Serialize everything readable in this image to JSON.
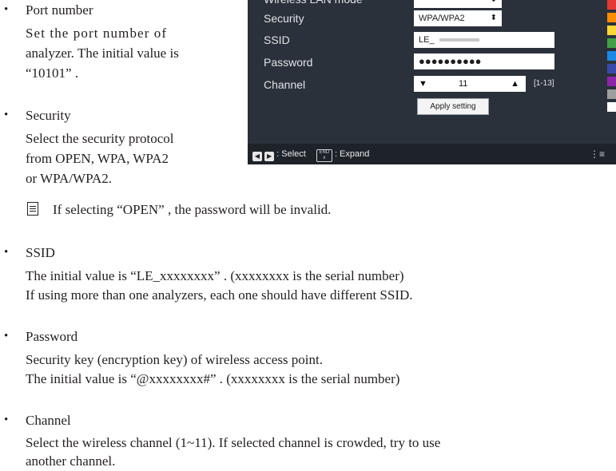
{
  "screen": {
    "rows": {
      "mode": "Wireless LAN mode",
      "security": "Security",
      "ssid": "SSID",
      "password": "Password",
      "channel": "Channel"
    },
    "security_value": "WPA/WPA2",
    "ssid_value": "LE_",
    "password_value": "●●●●●●●●●●",
    "channel_value": "11",
    "channel_range": "[1-13]",
    "apply_label": "Apply setting",
    "footer": {
      "select_label": ": Select",
      "expand_label": ": Expand",
      "key_label": "END"
    },
    "strip_colors": [
      "#e53935",
      "#fb8c00",
      "#fdd835",
      "#43a047",
      "#1e88e5",
      "#3949ab",
      "#8e24aa",
      "#9e9e9e",
      "#ffffff"
    ]
  },
  "doc": {
    "items": [
      {
        "bullet": "•",
        "term": "Port number",
        "desc": [
          "Set the port number of",
          "analyzer. The initial value is",
          "“10101” ."
        ]
      },
      {
        "bullet": "•",
        "term": "Security",
        "desc": [
          "Select the security protocol",
          "from OPEN, WPA, WPA2",
          "or WPA/WPA2."
        ]
      },
      {
        "bullet": "•",
        "term": "SSID",
        "desc": [
          "The initial value is “LE_xxxxxxxx” . (xxxxxxxx is the serial number)",
          "If using more than one analyzers, each one should have different SSID."
        ]
      },
      {
        "bullet": "•",
        "term": "Password",
        "desc": [
          "Security key (encryption key) of wireless access point.",
          "The initial value is “@xxxxxxxx#” . (xxxxxxxx is the serial number)"
        ]
      },
      {
        "bullet": "•",
        "term": "Channel",
        "desc": [
          "Select the wireless channel (1~11). If selected channel is crowded, try to use",
          "another channel."
        ]
      }
    ],
    "note": "If selecting “OPEN” , the password will be invalid."
  }
}
